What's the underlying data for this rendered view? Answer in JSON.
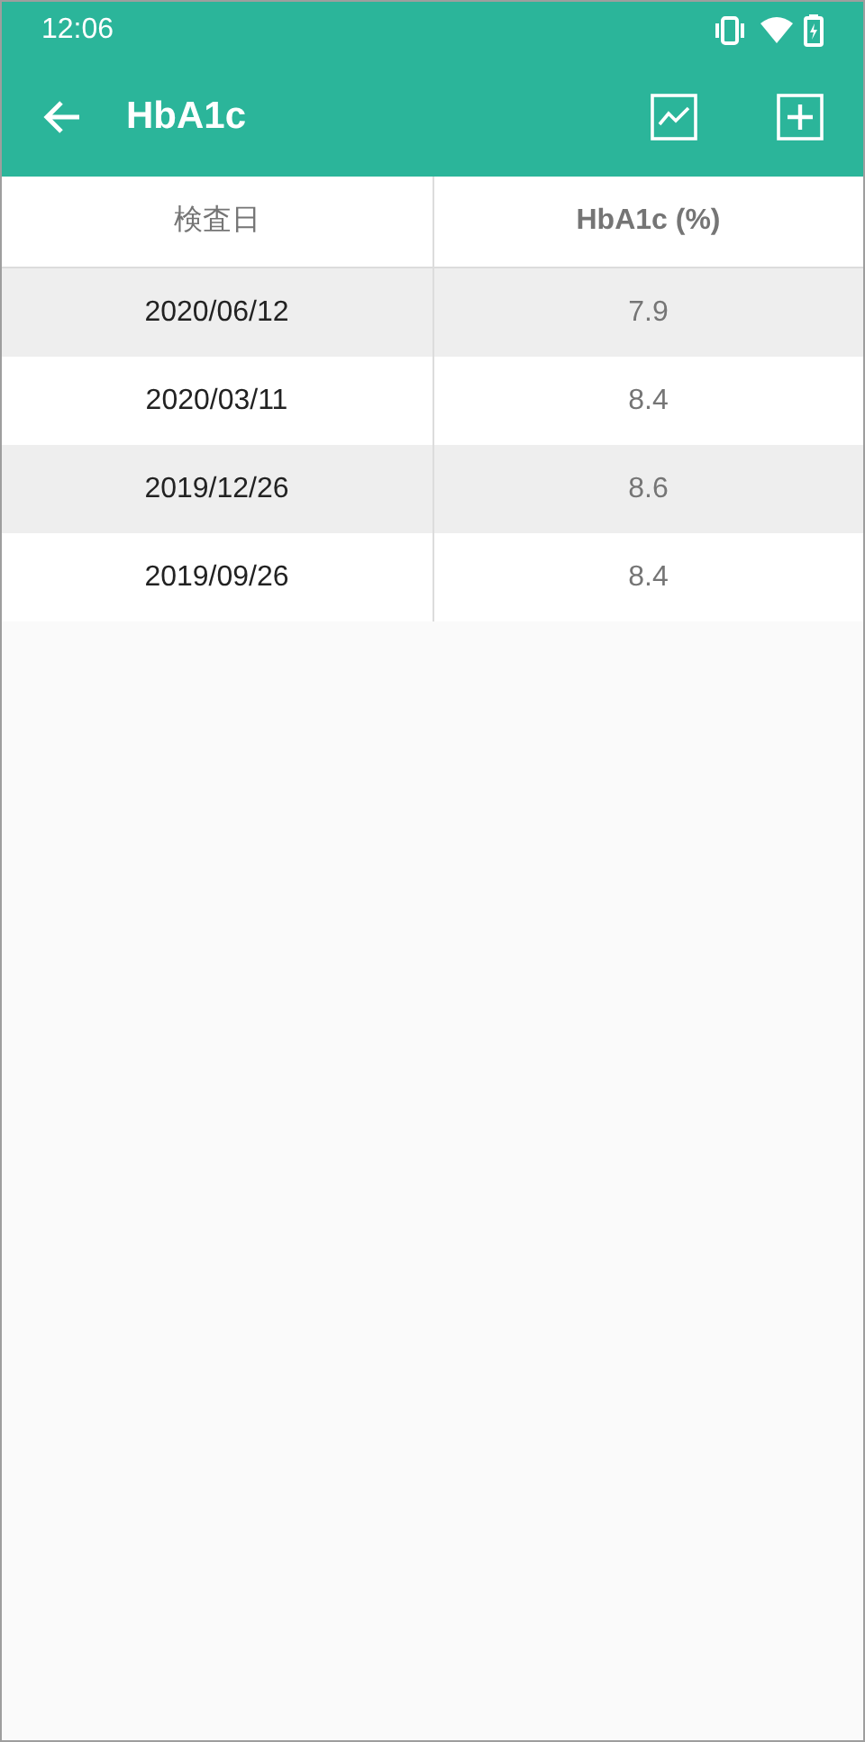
{
  "status_bar": {
    "time": "12:06"
  },
  "app_bar": {
    "title": "HbA1c"
  },
  "table": {
    "columns": [
      "検査日",
      "HbA1c (%)"
    ],
    "rows": [
      [
        "2020/06/12",
        "7.9"
      ],
      [
        "2020/03/11",
        "8.4"
      ],
      [
        "2019/12/26",
        "8.6"
      ],
      [
        "2019/09/26",
        "8.4"
      ]
    ]
  }
}
